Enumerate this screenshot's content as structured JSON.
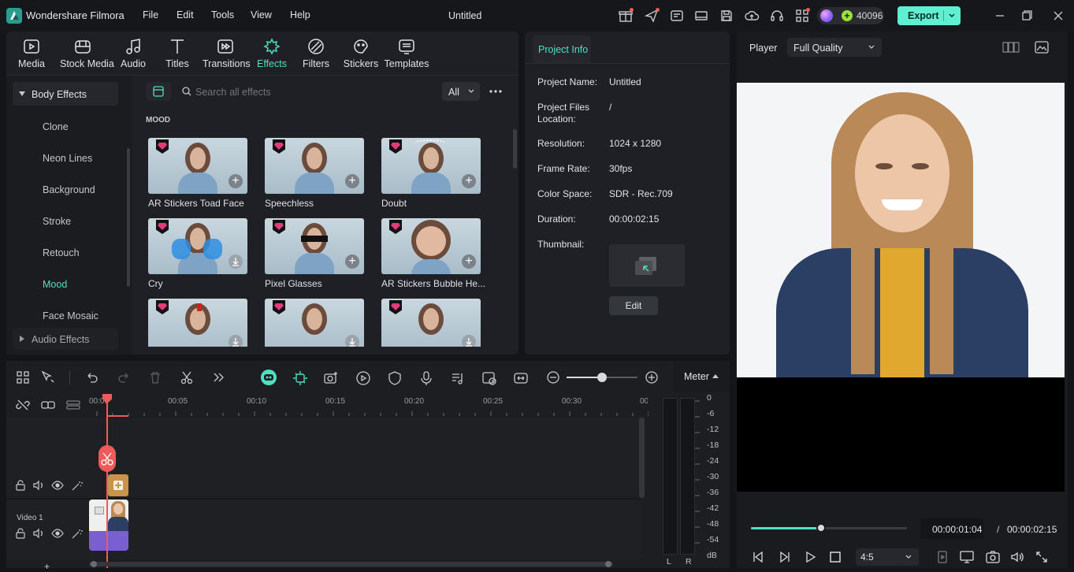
{
  "app": {
    "name": "Wondershare Filmora",
    "title": "Untitled",
    "credits": "40096",
    "export_label": "Export"
  },
  "menu": [
    "File",
    "Edit",
    "Tools",
    "View",
    "Help"
  ],
  "toolbar": [
    {
      "label": "Media",
      "icon": "media-icon"
    },
    {
      "label": "Stock Media",
      "icon": "stock-media-icon"
    },
    {
      "label": "Audio",
      "icon": "audio-icon"
    },
    {
      "label": "Titles",
      "icon": "titles-icon"
    },
    {
      "label": "Transitions",
      "icon": "transitions-icon"
    },
    {
      "label": "Effects",
      "icon": "effects-icon"
    },
    {
      "label": "Filters",
      "icon": "filters-icon"
    },
    {
      "label": "Stickers",
      "icon": "stickers-icon"
    },
    {
      "label": "Templates",
      "icon": "templates-icon"
    }
  ],
  "categories": {
    "group": "Body Effects",
    "items": [
      "Clone",
      "Neon Lines",
      "Background",
      "Stroke",
      "Retouch",
      "Mood",
      "Face Mosaic"
    ],
    "active": "Mood",
    "collapsed_group": "Audio Effects"
  },
  "search": {
    "placeholder": "Search all effects",
    "filter": "All"
  },
  "section_title": "MOOD",
  "effects": [
    "AR Stickers Toad Face",
    "Speechless",
    "Doubt",
    "Cry",
    "Pixel Glasses",
    "AR Stickers Bubble He...",
    "",
    "",
    ""
  ],
  "project_info": {
    "tab": "Project Info",
    "fields": [
      {
        "label": "Project Name:",
        "value": "Untitled"
      },
      {
        "label": "Project Files Location:",
        "value": "/"
      },
      {
        "label": "Resolution:",
        "value": "1024 x 1280"
      },
      {
        "label": "Frame Rate:",
        "value": "30fps"
      },
      {
        "label": "Color Space:",
        "value": "SDR - Rec.709"
      },
      {
        "label": "Duration:",
        "value": "00:00:02:15"
      }
    ],
    "thumbnail_label": "Thumbnail:",
    "edit_label": "Edit"
  },
  "player": {
    "label": "Player",
    "quality": "Full Quality",
    "current_time": "00:00:01:04",
    "separator": "/",
    "total_time": "00:00:02:15",
    "aspect": "4:5",
    "progress": 0.45
  },
  "timeline": {
    "ticks": [
      "00:00",
      "00:05",
      "00:10",
      "00:15",
      "00:20",
      "00:25",
      "00:30",
      "00:"
    ],
    "track_label": "Video 1",
    "meter_label": "Meter",
    "db_scale": [
      "0",
      "-6",
      "-12",
      "-18",
      "-24",
      "-30",
      "-36",
      "-42",
      "-48",
      "-54",
      "dB"
    ],
    "channels": [
      "L",
      "R"
    ]
  },
  "colors": {
    "accent": "#4fe0c2",
    "playhead": "#f05a5a",
    "export": "#5ef0d0",
    "premium": "#e23a7a"
  }
}
